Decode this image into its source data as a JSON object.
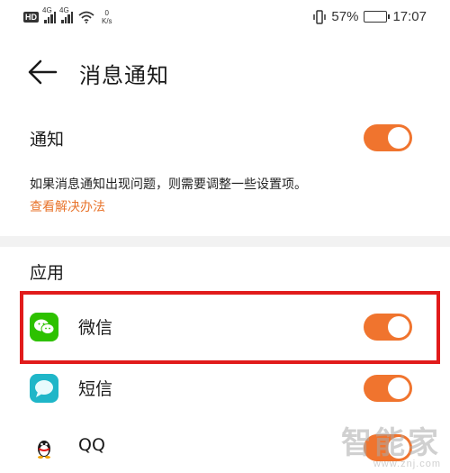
{
  "status_bar": {
    "hd": "HD",
    "network1": "4G",
    "network2": "4G",
    "speed_value": "0",
    "speed_unit": "K/s",
    "battery": "57%",
    "battery_level": 0.57,
    "time": "17:07"
  },
  "header": {
    "title": "消息通知"
  },
  "notification": {
    "label": "通知",
    "enabled": true,
    "hint": "如果消息通知出现问题，则需要调整一些设置项。",
    "link": "查看解决办法"
  },
  "apps_section": {
    "title": "应用",
    "items": [
      {
        "name": "微信",
        "icon": "wechat-icon",
        "enabled": true
      },
      {
        "name": "短信",
        "icon": "messages-icon",
        "enabled": true
      },
      {
        "name": "QQ",
        "icon": "qq-penguin-icon",
        "enabled": true
      }
    ]
  },
  "watermark": {
    "text": "智能家",
    "url": "www.znj.com"
  },
  "colors": {
    "accent": "#f0742e",
    "highlight": "#e11b1b",
    "link": "#e8742c",
    "wechat": "#2dc100",
    "sms": "#1fb6c8"
  }
}
